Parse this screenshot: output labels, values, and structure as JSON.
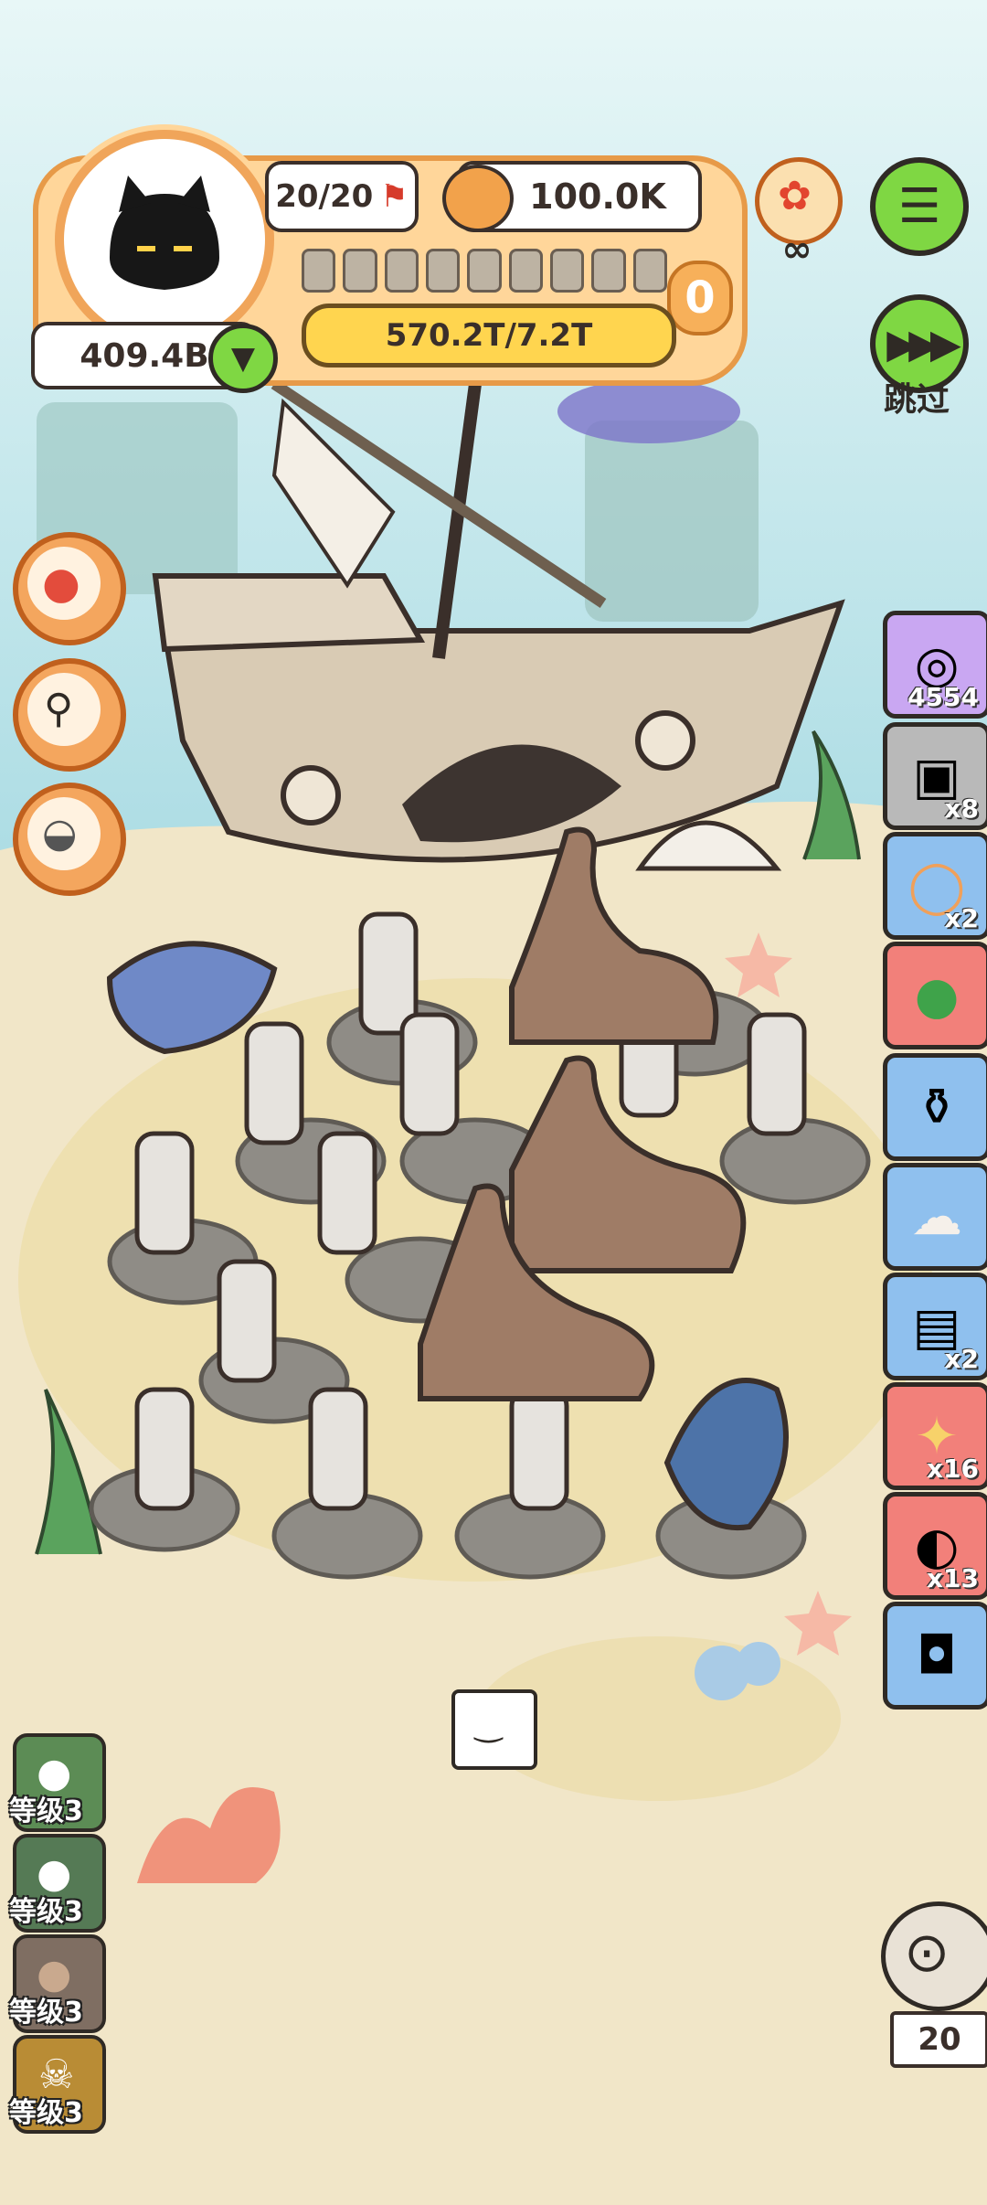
{
  "hud": {
    "capacity": "20/20",
    "currency": "100.0K",
    "progress_text": "570.2T/7.2T",
    "counter_value": "0",
    "gold": "409.4B",
    "skip_label": "跳过",
    "infinite_symbol": "∞"
  },
  "side_items": [
    {
      "name": "reel-item",
      "count": "4554"
    },
    {
      "name": "radio-item",
      "count": "x8"
    },
    {
      "name": "donut-item",
      "count": "x2"
    },
    {
      "name": "green-orb-item",
      "count": ""
    },
    {
      "name": "jar-item",
      "count": ""
    },
    {
      "name": "wig-item",
      "count": ""
    },
    {
      "name": "tin-item",
      "count": "x2"
    },
    {
      "name": "cracker-item",
      "count": "x16"
    },
    {
      "name": "pouch-item",
      "count": "x13"
    },
    {
      "name": "camera-item",
      "count": ""
    }
  ],
  "levels": [
    {
      "label": "等级3"
    },
    {
      "label": "等级3"
    },
    {
      "label": "等级3"
    },
    {
      "label": "等级3"
    }
  ],
  "owl_counter": "20",
  "colors": {
    "accent_orange": "#e79a48",
    "green_button": "#7fd743",
    "sand": "#f1e6c8",
    "water": "#bfe6ef"
  }
}
